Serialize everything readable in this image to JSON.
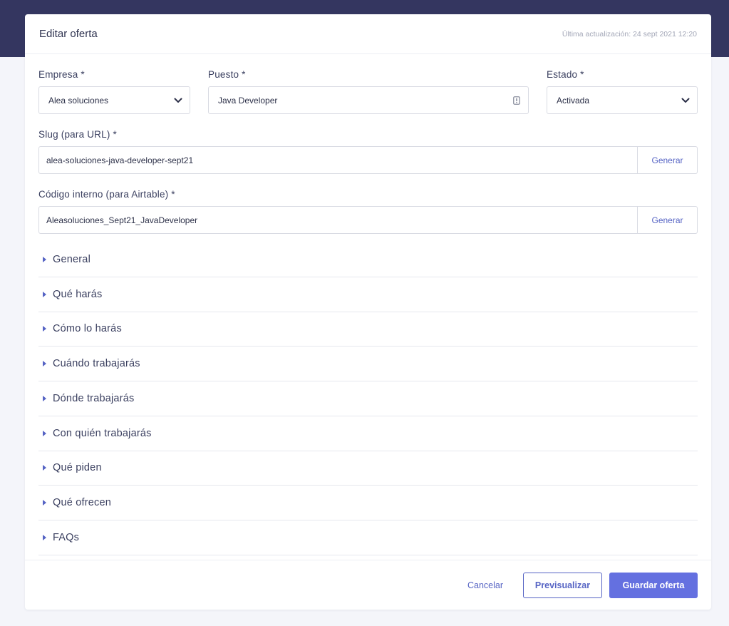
{
  "header": {
    "title": "Editar oferta",
    "last_updated": "Última actualización: 24 sept 2021 12:20"
  },
  "form": {
    "empresa": {
      "label": "Empresa *",
      "value": "Alea soluciones"
    },
    "puesto": {
      "label": "Puesto *",
      "value": "Java Developer"
    },
    "estado": {
      "label": "Estado *",
      "value": "Activada"
    },
    "slug": {
      "label": "Slug (para URL) *",
      "value": "alea-soluciones-java-developer-sept21",
      "button": "Generar"
    },
    "codigo": {
      "label": "Código interno (para Airtable) *",
      "value": "Aleasoluciones_Sept21_JavaDeveloper",
      "button": "Generar"
    }
  },
  "sections": [
    "General",
    "Qué harás",
    "Cómo lo harás",
    "Cuándo trabajarás",
    "Dónde trabajarás",
    "Con quién trabajarás",
    "Qué piden",
    "Qué ofrecen",
    "FAQs"
  ],
  "footer": {
    "cancel": "Cancelar",
    "preview": "Previsualizar",
    "save": "Guardar oferta"
  },
  "colors": {
    "header_band": "#343660",
    "accent": "#5664c4",
    "primary_button": "#6470e0"
  },
  "icons": {
    "select_chevron": "chevron-down-icon",
    "input_badge": "text-field-icon",
    "section_toggle": "caret-right-icon"
  }
}
